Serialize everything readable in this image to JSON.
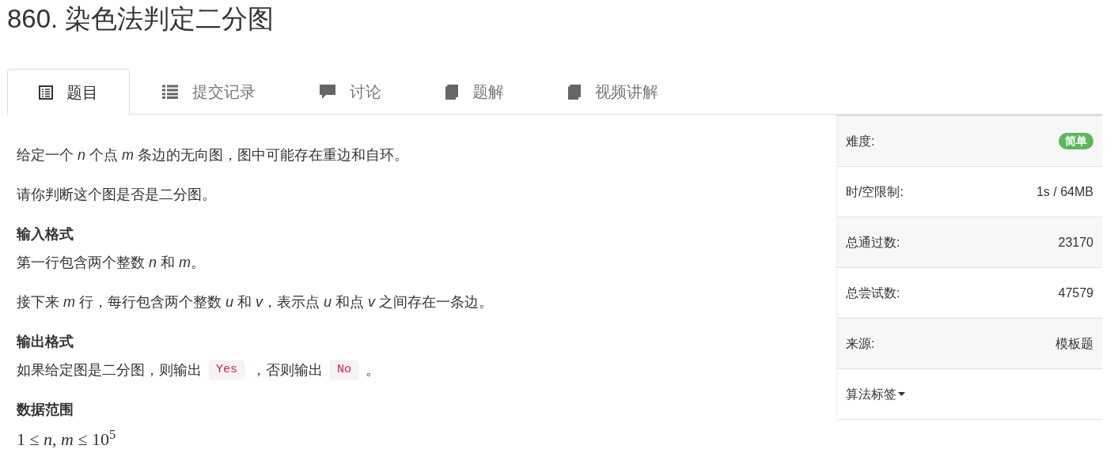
{
  "title": "860. 染色法判定二分图",
  "tabs": [
    {
      "label": "题目",
      "kind": "problem",
      "selected": true
    },
    {
      "label": "提交记录",
      "kind": "submissions",
      "selected": false
    },
    {
      "label": "讨论",
      "kind": "discussion",
      "selected": false
    },
    {
      "label": "题解",
      "kind": "solutions",
      "selected": false
    },
    {
      "label": "视频讲解",
      "kind": "video",
      "selected": false
    }
  ],
  "content": [
    {
      "kind": "text",
      "parts": [
        {
          "kind": "text",
          "text": "给定一个 *n* 个点 *m* 条边的无向图，图中可能存在重边和自环。"
        }
      ]
    },
    {
      "kind": "text",
      "parts": [
        {
          "kind": "text",
          "text": "请你判断这个图是否是二分图。"
        }
      ]
    },
    {
      "kind": "heading",
      "parts": [
        {
          "kind": "text",
          "text": "输入格式"
        }
      ]
    },
    {
      "kind": "text",
      "parts": [
        {
          "kind": "text",
          "text": "第一行包含两个整数 *n* 和 *m*。"
        }
      ]
    },
    {
      "kind": "text",
      "parts": [
        {
          "kind": "text",
          "text": "接下来 *m* 行，每行包含两个整数 *u* 和 *v*，表示点 *u* 和点 *v* 之间存在一条边。"
        }
      ]
    },
    {
      "kind": "heading",
      "parts": [
        {
          "kind": "text",
          "text": "输出格式"
        }
      ]
    },
    {
      "kind": "text",
      "parts": [
        {
          "kind": "text",
          "text": "如果给定图是二分图，则输出"
        },
        {
          "kind": "code",
          "text": "Yes"
        },
        {
          "kind": "text",
          "text": "，否则输出"
        },
        {
          "kind": "code",
          "text": "No"
        },
        {
          "kind": "text",
          "text": "。"
        }
      ]
    },
    {
      "kind": "heading",
      "parts": [
        {
          "kind": "text",
          "text": "数据范围"
        }
      ]
    },
    {
      "kind": "math",
      "parts": [
        {
          "kind": "text",
          "text": "1 ≤ *n*, *m* ≤ 10$^{5}$"
        }
      ]
    }
  ],
  "sidebar": [
    {
      "kind": "badge",
      "label": "难度:",
      "value": "简单",
      "color": "#5cb85c"
    },
    {
      "kind": "text",
      "label": "时/空限制:",
      "value": "1s / 64MB"
    },
    {
      "kind": "text",
      "label": "总通过数:",
      "value": "23170"
    },
    {
      "kind": "text",
      "label": "总尝试数:",
      "value": "47579"
    },
    {
      "kind": "text",
      "label": "来源:",
      "value": "模板题"
    },
    {
      "kind": "dropdown",
      "label": "算法标签"
    }
  ]
}
